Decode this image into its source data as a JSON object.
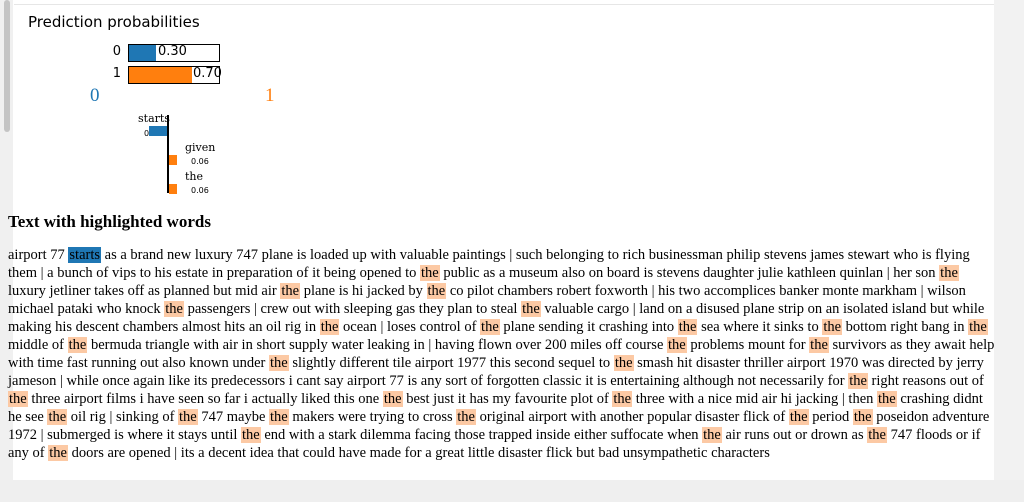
{
  "prediction": {
    "title": "Prediction probabilities",
    "rows": [
      {
        "label": "0",
        "value": "0.30",
        "prob": 0.3,
        "color": "#1f77b4"
      },
      {
        "label": "1",
        "value": "0.70",
        "prob": 0.7,
        "color": "#ff7f0e"
      }
    ],
    "class_left": "0",
    "class_right": "1",
    "class_left_color": "#1f77b4",
    "class_right_color": "#ff7f0e"
  },
  "features": [
    {
      "word": "starts",
      "value": "0.13",
      "side": "left",
      "weight": 0.13,
      "color": "#1f77b4"
    },
    {
      "word": "given",
      "value": "0.06",
      "side": "right",
      "weight": 0.06,
      "color": "#ff7f0e"
    },
    {
      "word": "the",
      "value": "0.06",
      "side": "right",
      "weight": 0.06,
      "color": "#ff7f0e"
    }
  ],
  "text_panel": {
    "heading": "Text with highlighted words",
    "highlight_colors": {
      "starts": "#1f77b4",
      "the": "#fcc9a4"
    },
    "segments": [
      {
        "t": "airport 77 "
      },
      {
        "t": "starts",
        "h": "starts"
      },
      {
        "t": " as a brand new luxury 747 plane is loaded up with valuable paintings | such belonging to rich businessman philip stevens james stewart who is flying them | a bunch of vips to his estate in preparation of it being opened to "
      },
      {
        "t": "the",
        "h": "the"
      },
      {
        "t": " public as a museum also on board is stevens daughter julie kathleen quinlan | her son "
      },
      {
        "t": "the",
        "h": "the"
      },
      {
        "t": " luxury jetliner takes off as planned but mid air "
      },
      {
        "t": "the",
        "h": "the"
      },
      {
        "t": " plane is hi jacked by "
      },
      {
        "t": "the",
        "h": "the"
      },
      {
        "t": " co pilot chambers robert foxworth | his two accomplices banker monte markham | wilson michael pataki who knock "
      },
      {
        "t": "the",
        "h": "the"
      },
      {
        "t": " passengers | crew out with sleeping gas they plan to steal "
      },
      {
        "t": "the",
        "h": "the"
      },
      {
        "t": " valuable cargo | land on a disused plane strip on an isolated island but while making his descent chambers almost hits an oil rig in "
      },
      {
        "t": "the",
        "h": "the"
      },
      {
        "t": " ocean | loses control of "
      },
      {
        "t": "the",
        "h": "the"
      },
      {
        "t": " plane sending it crashing into "
      },
      {
        "t": "the",
        "h": "the"
      },
      {
        "t": " sea where it sinks to "
      },
      {
        "t": "the",
        "h": "the"
      },
      {
        "t": " bottom right bang in "
      },
      {
        "t": "the",
        "h": "the"
      },
      {
        "t": " middle of "
      },
      {
        "t": "the",
        "h": "the"
      },
      {
        "t": " bermuda triangle with air in short supply water leaking in | having flown over 200 miles off course "
      },
      {
        "t": "the",
        "h": "the"
      },
      {
        "t": " problems mount for "
      },
      {
        "t": "the",
        "h": "the"
      },
      {
        "t": " survivors as they await help with time fast running out also known under "
      },
      {
        "t": "the",
        "h": "the"
      },
      {
        "t": " slightly different tile airport 1977 this second sequel to "
      },
      {
        "t": "the",
        "h": "the"
      },
      {
        "t": " smash hit disaster thriller airport 1970 was directed by jerry jameson | while once again like its predecessors i cant say airport 77 is any sort of forgotten classic it is entertaining although not necessarily for "
      },
      {
        "t": "the",
        "h": "the"
      },
      {
        "t": " right reasons out of "
      },
      {
        "t": "the",
        "h": "the"
      },
      {
        "t": " three airport films i have seen so far i actually liked this one "
      },
      {
        "t": "the",
        "h": "the"
      },
      {
        "t": " best just it has my favourite plot of "
      },
      {
        "t": "the",
        "h": "the"
      },
      {
        "t": " three with a nice mid air hi jacking | then "
      },
      {
        "t": "the",
        "h": "the"
      },
      {
        "t": " crashing didnt he see "
      },
      {
        "t": "the",
        "h": "the"
      },
      {
        "t": " oil rig | sinking of "
      },
      {
        "t": "the",
        "h": "the"
      },
      {
        "t": " 747 maybe "
      },
      {
        "t": "the",
        "h": "the"
      },
      {
        "t": " makers were trying to cross "
      },
      {
        "t": "the",
        "h": "the"
      },
      {
        "t": " original airport with another popular disaster flick of "
      },
      {
        "t": "the",
        "h": "the"
      },
      {
        "t": " period "
      },
      {
        "t": "the",
        "h": "the"
      },
      {
        "t": " poseidon adventure 1972 | submerged is where it stays until "
      },
      {
        "t": "the",
        "h": "the"
      },
      {
        "t": " end with a stark dilemma facing those trapped inside either suffocate when "
      },
      {
        "t": "the",
        "h": "the"
      },
      {
        "t": " air runs out or drown as "
      },
      {
        "t": "the",
        "h": "the"
      },
      {
        "t": " 747 floods or if any of "
      },
      {
        "t": "the",
        "h": "the"
      },
      {
        "t": " doors are opened | its a decent idea that could have made for a great little disaster flick but bad unsympathetic characters"
      }
    ]
  }
}
